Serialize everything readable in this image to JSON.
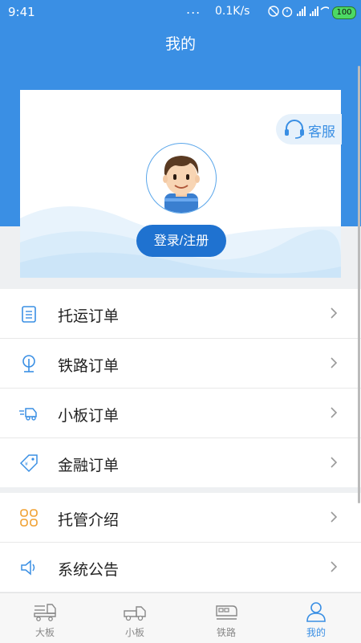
{
  "status_bar": {
    "time": "9:41",
    "dots": "...",
    "speed": "0.1K/s",
    "battery": "100"
  },
  "header": {
    "title": "我的"
  },
  "profile": {
    "customer_service_label": "客服",
    "login_button": "登录/注册"
  },
  "menu_group_1": [
    {
      "label": "托运订单",
      "icon": "clipboard-icon"
    },
    {
      "label": "铁路订单",
      "icon": "rail-sign-icon"
    },
    {
      "label": "小板订单",
      "icon": "truck-speed-icon"
    },
    {
      "label": "金融订单",
      "icon": "finance-tag-icon"
    }
  ],
  "menu_group_2": [
    {
      "label": "托管介绍",
      "icon": "grid-clover-icon"
    },
    {
      "label": "系统公告",
      "icon": "speaker-icon"
    }
  ],
  "tabs": [
    {
      "label": "大板",
      "icon": "large-truck-icon",
      "active": false
    },
    {
      "label": "小板",
      "icon": "small-truck-icon",
      "active": false
    },
    {
      "label": "铁路",
      "icon": "train-icon",
      "active": false
    },
    {
      "label": "我的",
      "icon": "user-icon",
      "active": true
    }
  ],
  "colors": {
    "primary": "#3a8fe4",
    "button": "#1f72d0",
    "icon_orange": "#f0a030"
  }
}
